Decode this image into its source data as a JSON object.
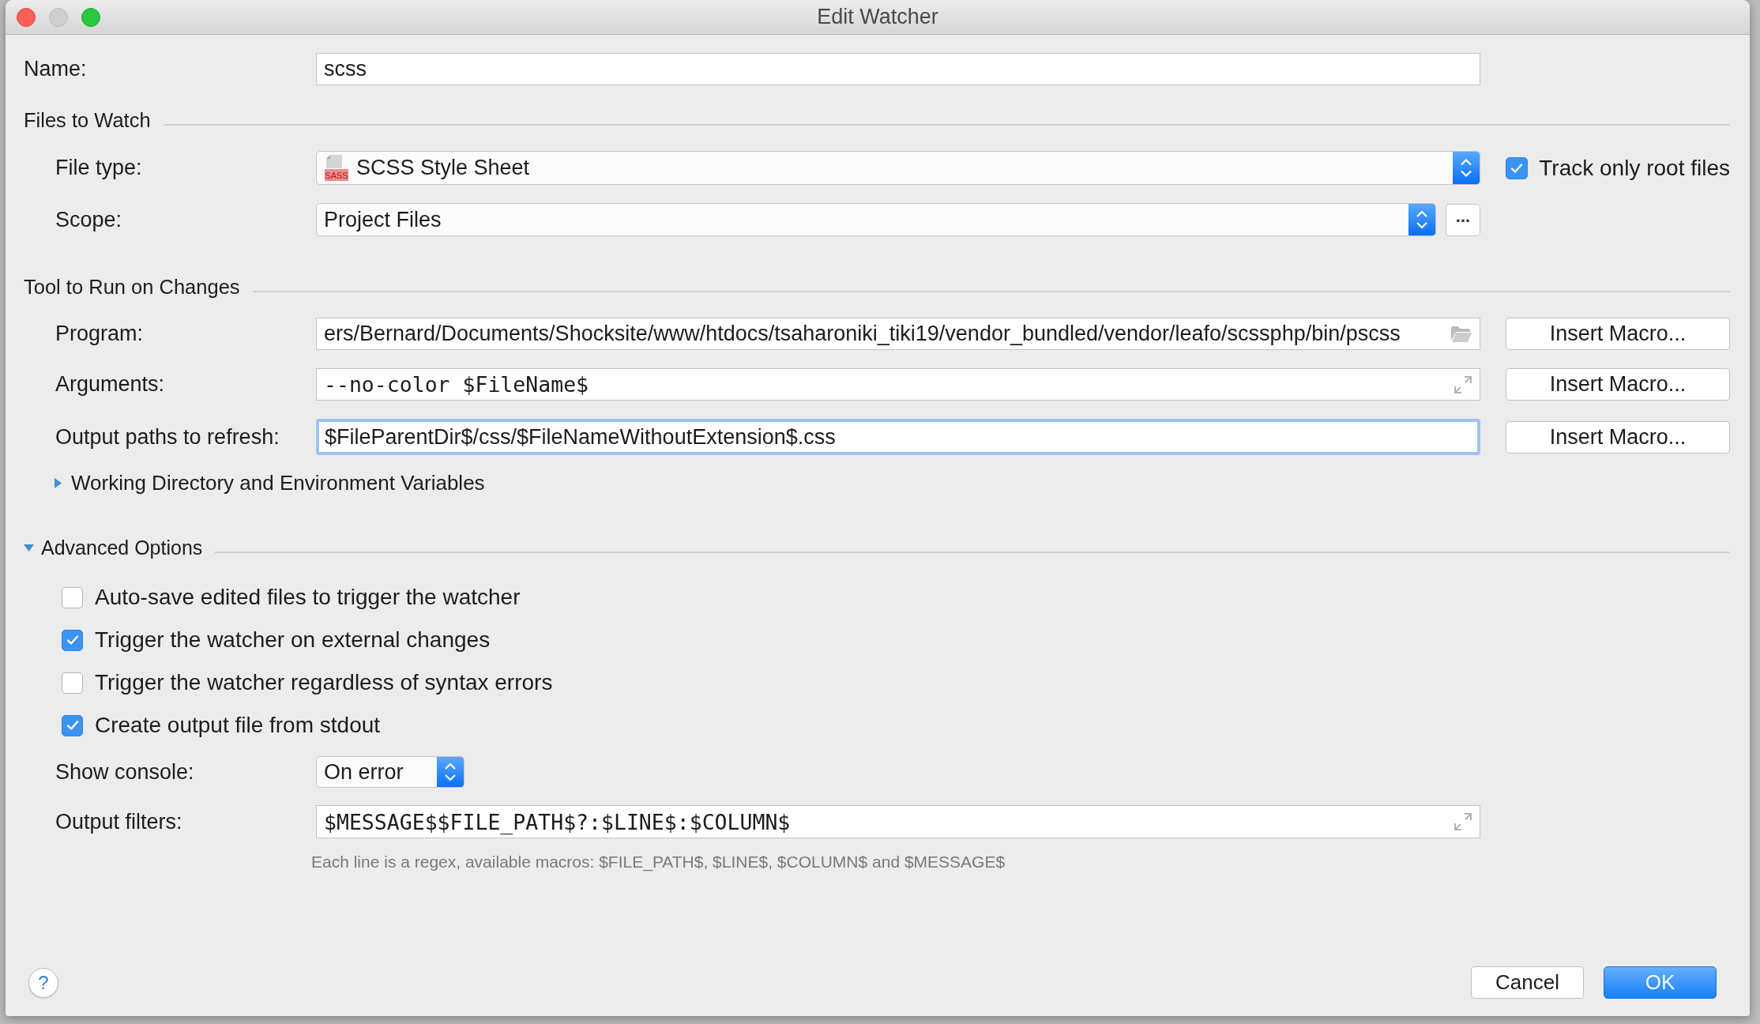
{
  "window": {
    "title": "Edit Watcher",
    "controls": [
      {
        "kind": "close",
        "disabled": false
      },
      {
        "kind": "minimize",
        "disabled": true
      },
      {
        "kind": "zoom",
        "disabled": false
      }
    ]
  },
  "name_field": {
    "label": "Name:",
    "value": "scss"
  },
  "files_to_watch": {
    "heading": "Files to Watch",
    "file_type": {
      "label": "File type:",
      "value": "SCSS Style Sheet",
      "icon_label": "SASS"
    },
    "track_only_root_files": {
      "label": "Track only root files",
      "checked": true
    },
    "scope": {
      "label": "Scope:",
      "value": "Project Files",
      "browse_button": "..."
    }
  },
  "tool_to_run": {
    "heading": "Tool to Run on Changes",
    "fields": [
      {
        "kind": "path",
        "label": "Program:",
        "value": "ers/Bernard/Documents/Shocksite/www/htdocs/tsaharoniki_tiki19/vendor_bundled/vendor/leafo/scssphp/bin/pscss",
        "focused": false,
        "button": "Insert Macro..."
      },
      {
        "kind": "expandable",
        "label": "Arguments:",
        "value": "--no-color $FileName$",
        "focused": false,
        "button": "Insert Macro..."
      },
      {
        "kind": "plain",
        "label": "Output paths to refresh:",
        "value": "$FileParentDir$/css/$FileNameWithoutExtension$.css",
        "focused": true,
        "button": "Insert Macro..."
      }
    ],
    "working_directory": {
      "label": "Working Directory and Environment Variables",
      "expanded": false
    }
  },
  "advanced_options": {
    "heading": "Advanced Options",
    "expanded": true,
    "options": [
      {
        "label": "Auto-save edited files to trigger the watcher",
        "checked": false
      },
      {
        "label": "Trigger the watcher on external changes",
        "checked": true
      },
      {
        "label": "Trigger the watcher regardless of syntax errors",
        "checked": false
      },
      {
        "label": "Create output file from stdout",
        "checked": true
      }
    ],
    "show_console": {
      "label": "Show console:",
      "value": "On error"
    },
    "output_filters": {
      "label": "Output filters:",
      "value": "$MESSAGE$$FILE_PATH$?:$LINE$:$COLUMN$",
      "hint": "Each line is a regex, available macros: $FILE_PATH$, $LINE$, $COLUMN$ and $MESSAGE$"
    }
  },
  "footer": {
    "help_button": "?",
    "buttons": [
      {
        "label": "Cancel",
        "default": false
      },
      {
        "label": "OK",
        "default": true
      }
    ]
  }
}
